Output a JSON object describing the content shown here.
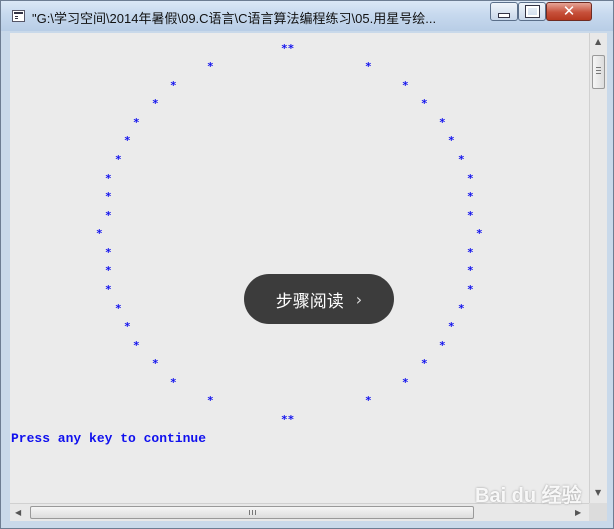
{
  "window": {
    "title": "\"G:\\学习空间\\2014年暑假\\09.C语言\\C语言算法编程练习\\05.用星号绘...",
    "controls": {
      "minimize": "—",
      "maximize": "□",
      "close": "✕"
    }
  },
  "console": {
    "star_glyph": "*",
    "prompt": "Press any key to continue",
    "text_color": "#1010ee",
    "background": "#ebebeb"
  },
  "overlay": {
    "label": "步骤阅读",
    "chevron": "›"
  },
  "watermark": {
    "text": "Bai du 经验"
  }
}
